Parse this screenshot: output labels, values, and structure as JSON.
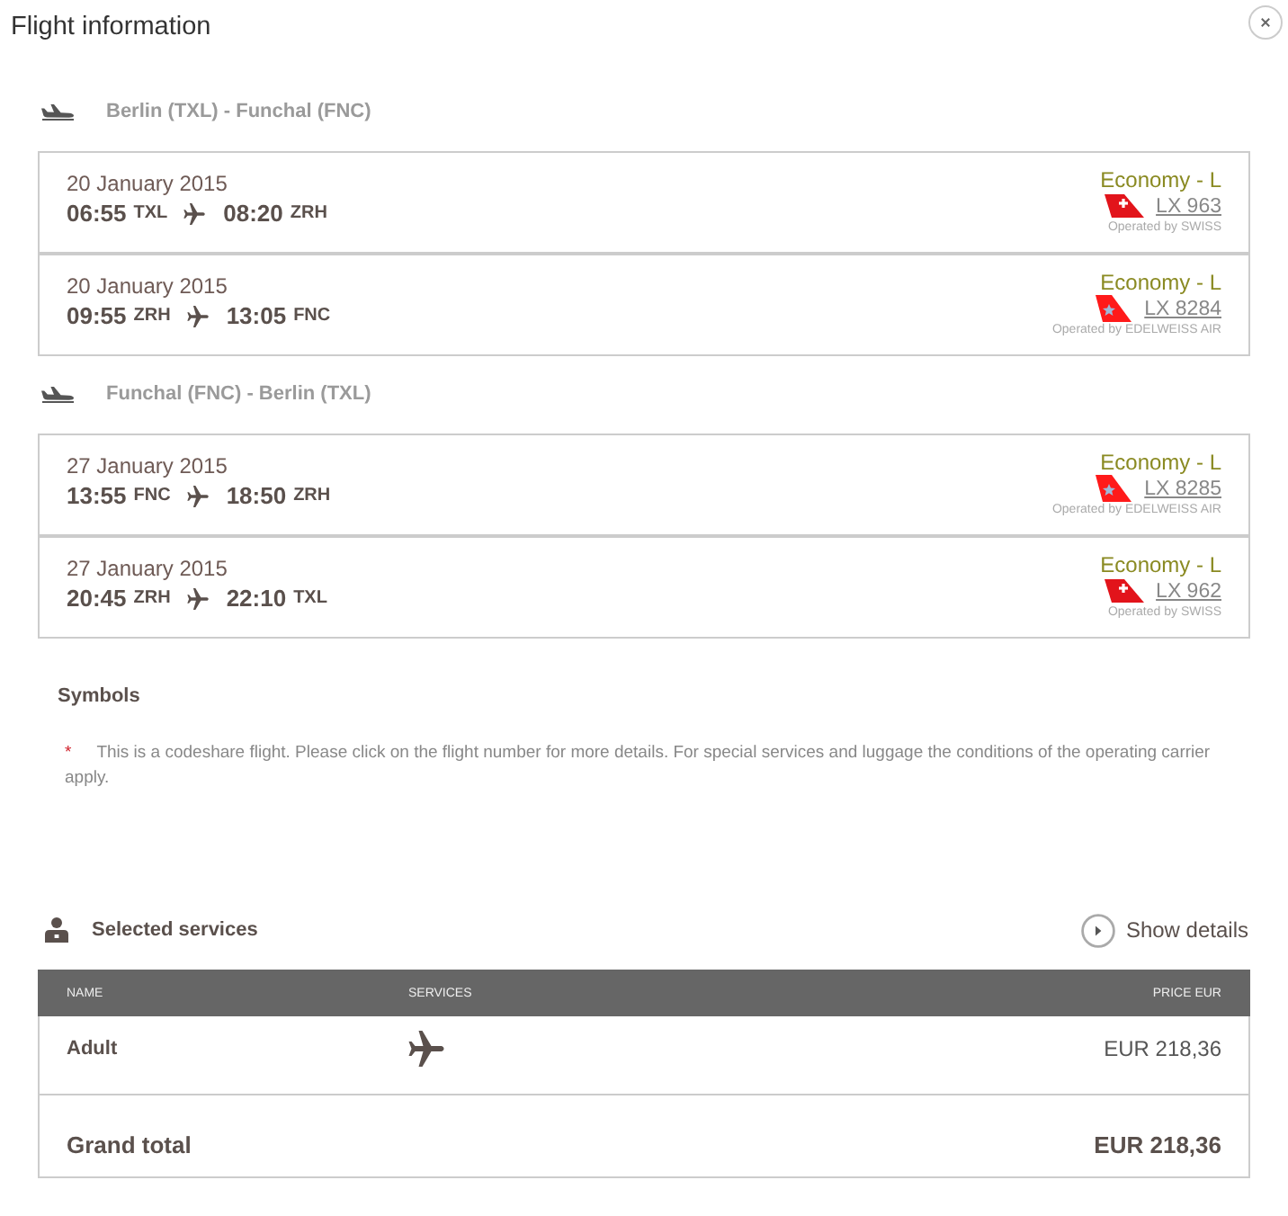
{
  "window": {
    "title": "Flight information"
  },
  "journeys": [
    {
      "route": "Berlin (TXL) - Funchal (FNC)",
      "flights": [
        {
          "kind": "cross",
          "date": "20 January 2015",
          "departure_time": "06:55",
          "departure_airport": "TXL",
          "arrival_time": "08:20",
          "arrival_airport": "ZRH",
          "fare_class": "Economy - L",
          "flight_number": "LX 963",
          "operated_by": "Operated by SWISS"
        },
        {
          "kind": "star",
          "date": "20 January 2015",
          "departure_time": "09:55",
          "departure_airport": "ZRH",
          "arrival_time": "13:05",
          "arrival_airport": "FNC",
          "fare_class": "Economy - L",
          "flight_number": "LX 8284",
          "operated_by": "Operated by EDELWEISS AIR"
        }
      ]
    },
    {
      "route": "Funchal (FNC) - Berlin (TXL)",
      "flights": [
        {
          "kind": "star",
          "date": "27 January 2015",
          "departure_time": "13:55",
          "departure_airport": "FNC",
          "arrival_time": "18:50",
          "arrival_airport": "ZRH",
          "fare_class": "Economy - L",
          "flight_number": "LX 8285",
          "operated_by": "Operated by EDELWEISS AIR"
        },
        {
          "kind": "cross",
          "date": "27 January 2015",
          "departure_time": "20:45",
          "departure_airport": "ZRH",
          "arrival_time": "22:10",
          "arrival_airport": "TXL",
          "fare_class": "Economy - L",
          "flight_number": "LX 962",
          "operated_by": "Operated by SWISS"
        }
      ]
    }
  ],
  "symbols": {
    "title": "Symbols",
    "notes": [
      {
        "mark": "*",
        "text": "This is a codeshare flight. Please click on the flight number for more details. For special services and luggage the conditions of the operating carrier apply."
      }
    ]
  },
  "services": {
    "title": "Selected services",
    "details_link": "Show details",
    "columns": [
      "NAME",
      "SERVICES",
      "PRICE EUR"
    ],
    "rows": [
      {
        "name": "Adult",
        "price": "EUR 218,36"
      }
    ],
    "total": {
      "label": "Grand total",
      "price": "EUR 218,36"
    }
  }
}
